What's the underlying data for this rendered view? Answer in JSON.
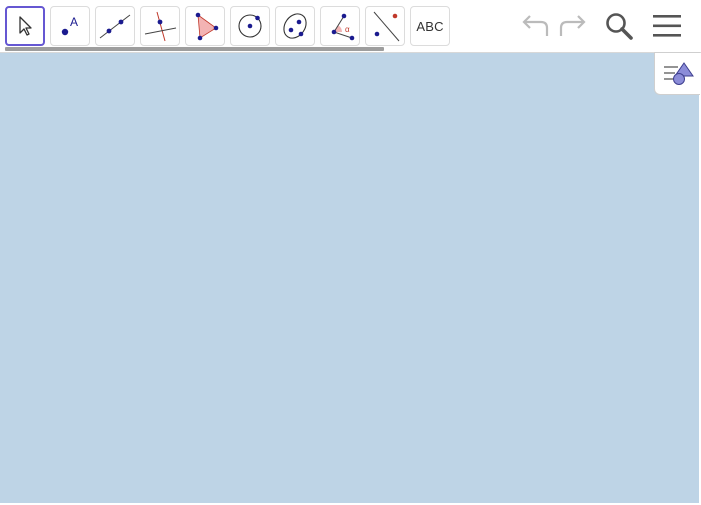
{
  "toolbar": {
    "tools": [
      {
        "id": "move",
        "icon": "move-arrow-icon",
        "selected": true
      },
      {
        "id": "point",
        "icon": "point-icon",
        "label": "A"
      },
      {
        "id": "line",
        "icon": "line-icon"
      },
      {
        "id": "perpendicular",
        "icon": "perpendicular-line-icon"
      },
      {
        "id": "polygon",
        "icon": "polygon-icon"
      },
      {
        "id": "circle",
        "icon": "circle-center-point-icon"
      },
      {
        "id": "ellipse",
        "icon": "ellipse-icon"
      },
      {
        "id": "angle",
        "icon": "angle-icon",
        "label": "α"
      },
      {
        "id": "reflect",
        "icon": "reflect-line-icon"
      },
      {
        "id": "text",
        "icon": "text-icon",
        "label": "ABC"
      }
    ],
    "actions": {
      "undo": "undo-icon",
      "redo": "redo-icon",
      "search": "search-icon",
      "menu": "hamburger-menu-icon"
    }
  },
  "algebra_toggle": {
    "icon": "algebra-view-icon"
  },
  "colors": {
    "graphics_bg": "#bed4e6",
    "selected_border": "#6557d2",
    "point": "#1b1b8f",
    "polygon_fill": "#f3b3b3",
    "accent_red": "#c0392b",
    "icon_gray": "#444444",
    "disabled_gray": "#bbbbbb"
  }
}
